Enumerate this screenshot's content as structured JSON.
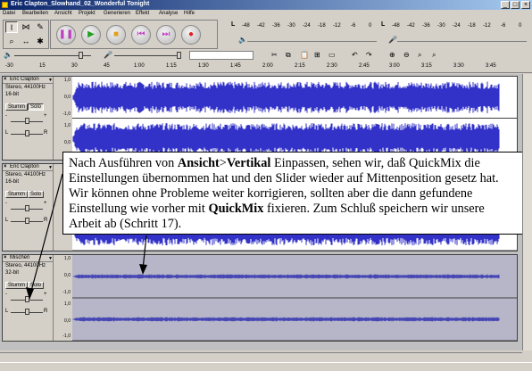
{
  "window": {
    "title": "Eric Clapton_Slowhand_02_Wonderful Tonight",
    "minimize": "_",
    "maximize": "□",
    "close": "×"
  },
  "menu": [
    "Datei",
    "Bearbeiten",
    "Ansicht",
    "Projekt",
    "Generieren",
    "Effekt",
    "Analyse",
    "Hilfe"
  ],
  "meters": {
    "playback_label": "L",
    "record_label": "L",
    "ticks": [
      "-48",
      "-42",
      "-36",
      "-30",
      "-24",
      "-18",
      "-12",
      "-6",
      "0"
    ]
  },
  "ruler": {
    "labels": [
      "-30",
      "15",
      "30",
      "45",
      "1:00",
      "1:15",
      "1:30",
      "1:45",
      "2:00",
      "2:15",
      "2:30",
      "2:45",
      "3:00",
      "3:15",
      "3:30",
      "3:45"
    ]
  },
  "tracks": [
    {
      "name": "Eric Clapton",
      "format": "Stereo, 44100Hz",
      "bits": "16-bit",
      "mute": "Stumm",
      "solo": "Solo",
      "gain_minus": "-",
      "gain_plus": "+",
      "pan_l": "L",
      "pan_r": "R",
      "gain_level": 0.5,
      "pan_level": 0.5,
      "solo_pressed": true
    },
    {
      "name": "Eric Clapton",
      "format": "Stereo, 44100Hz",
      "bits": "16-bit",
      "mute": "Stumm",
      "solo": "Solo",
      "gain_minus": "-",
      "gain_plus": "+",
      "pan_l": "L",
      "pan_r": "R",
      "gain_level": 0.5,
      "pan_level": 0.5,
      "solo_pressed": false
    },
    {
      "name": "Mischen",
      "format": "Stereo, 44100Hz",
      "bits": "32-bit",
      "mute": "Stumm",
      "solo": "Solo",
      "gain_minus": "-",
      "gain_plus": "+",
      "pan_l": "L",
      "pan_r": "R",
      "gain_level": 0.5,
      "pan_level": 0.5,
      "solo_pressed": false
    }
  ],
  "scale": {
    "top": "1,0",
    "mid": "0,0",
    "bottom": "-1,0"
  },
  "note": {
    "t1": "Nach Ausführen von ",
    "b1": "Ansicht",
    "t2": ">",
    "b2": "Vertikal",
    "t3": " Einpassen, sehen wir, daß QuickMix die Einstellungen übernommen hat und den Slider wieder auf Mittenposition gesetz hat. Wir können ohne Probleme weiter korrigieren, sollten aber die dann gefundene Einstellung wie vorher mit ",
    "b3": "QuickMix",
    "t4": " fixieren. Zum Schluß speichern wir unsere Arbeit ab (Schritt 17)."
  },
  "colors": {
    "wave": "#3232c8",
    "wave_dim": "#4646b4",
    "title_start": "#0a246a",
    "title_end": "#a6caf0"
  }
}
